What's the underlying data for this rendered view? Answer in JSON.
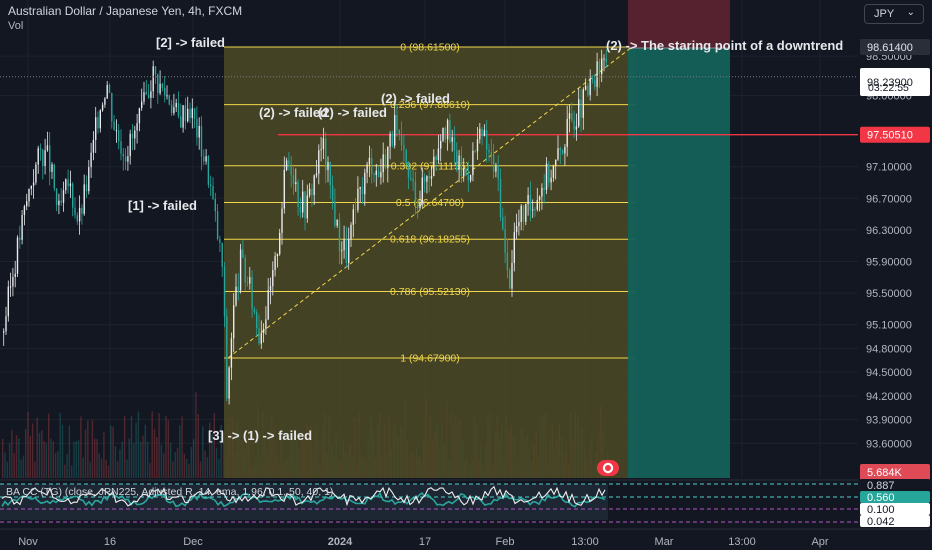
{
  "header": {
    "symbol_line": "Australian Dollar / Japanese Yen, 4h, FXCM",
    "volume_label": "Vol",
    "currency_button": "JPY"
  },
  "oscillator": {
    "label": "BA⁠ CC (TG) (close, JPN225, Adjusted R, 14, ema, 1.96, 0.1, 50, 40, 1)",
    "levels": [
      "0.887",
      "0.560",
      "0.100",
      "0.042"
    ]
  },
  "chart_data": {
    "type": "candlestick",
    "instrument": "Australian Dollar / Japanese Yen",
    "timeframe": "4h",
    "price_axis": {
      "ticks": [
        "98.50000",
        "98.00000",
        "97.10000",
        "96.70000",
        "96.30000",
        "95.90000",
        "95.50000",
        "95.10000",
        "94.80000",
        "94.50000",
        "94.20000",
        "93.90000",
        "93.60000"
      ]
    },
    "price_badges": {
      "top": "98.61400",
      "last_price": "98.23900",
      "countdown": "03:22:55",
      "horizontal_line": "97.50510",
      "volume": "5.684K"
    },
    "time_axis": [
      "Nov",
      "16",
      "Dec",
      "2024",
      "17",
      "Feb",
      "13:00",
      "Mar",
      "13:00",
      "Apr"
    ],
    "fibonacci": [
      {
        "ratio": "0",
        "price": "98.61500",
        "label": "0 (98.61500)"
      },
      {
        "ratio": "0.236",
        "price": "97.88610",
        "label": "0.236 (97.88610)"
      },
      {
        "ratio": "0.382",
        "price": "97.11155",
        "label": "0.382 (97.11155)"
      },
      {
        "ratio": "0.5",
        "price": "96.64700",
        "label": "0.5 (96.64700)"
      },
      {
        "ratio": "0.618",
        "price": "96.18255",
        "label": "0.618 (96.18255)"
      },
      {
        "ratio": "0.786",
        "price": "95.52130",
        "label": "0.786 (95.52130)"
      },
      {
        "ratio": "1",
        "price": "94.67900",
        "label": "1 (94.67900)"
      }
    ],
    "annotations": [
      "[2] -> failed",
      "(2) -> failed",
      "(2) -> failed",
      "(2) -> failed",
      "[1] -> failed",
      "[3] -> (1) -> failed",
      "(2) -> The staring point of a downtrend"
    ],
    "position_tool": {
      "entry": "98.61400",
      "style": "short"
    },
    "colors": {
      "up": "#26a69a",
      "down": "#ef5350",
      "fib": "#f0d64a",
      "fib_fill": "#4d4a24",
      "red_line": "#f23645",
      "stop_zone": "#5b2330",
      "target_zone": "#13615a",
      "badge_red": "#f23645",
      "badge_white": "#ffffff"
    }
  }
}
